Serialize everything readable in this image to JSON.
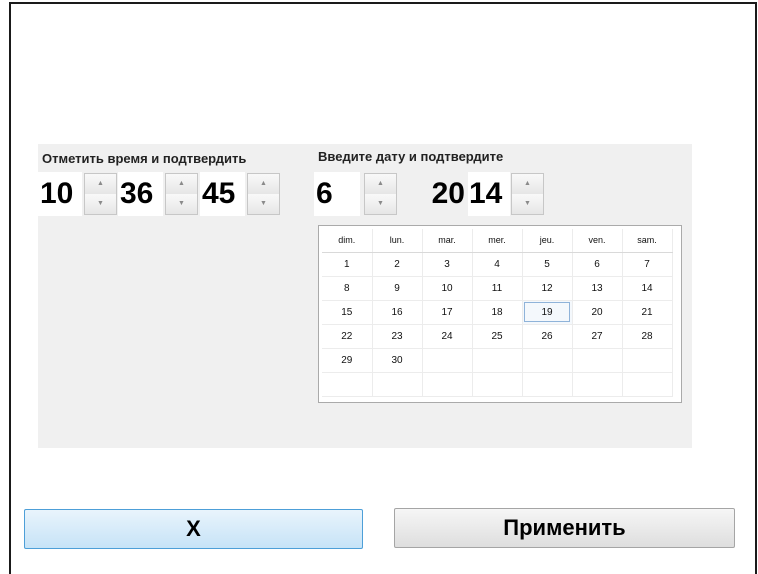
{
  "time_section": {
    "caption": "Отметить время и подтвердить",
    "hours": "10",
    "minutes": "36",
    "seconds": "45"
  },
  "date_section": {
    "caption": "Введите дату и подтвердите",
    "month": "6",
    "year_prefix": "20",
    "year_suffix": "14"
  },
  "calendar": {
    "weekdays": [
      "dim.",
      "lun.",
      "mar.",
      "mer.",
      "jeu.",
      "ven.",
      "sam."
    ],
    "weeks": [
      [
        "1",
        "2",
        "3",
        "4",
        "5",
        "6",
        "7"
      ],
      [
        "8",
        "9",
        "10",
        "11",
        "12",
        "13",
        "14"
      ],
      [
        "15",
        "16",
        "17",
        "18",
        "19",
        "20",
        "21"
      ],
      [
        "22",
        "23",
        "24",
        "25",
        "26",
        "27",
        "28"
      ],
      [
        "29",
        "30",
        "",
        "",
        "",
        "",
        ""
      ],
      [
        "",
        "",
        "",
        "",
        "",
        "",
        ""
      ]
    ],
    "selected_day": "19"
  },
  "spinner": {
    "up_glyph": "▲",
    "down_glyph": "▼"
  },
  "buttons": {
    "cancel_label": "X",
    "apply_label": "Применить"
  }
}
